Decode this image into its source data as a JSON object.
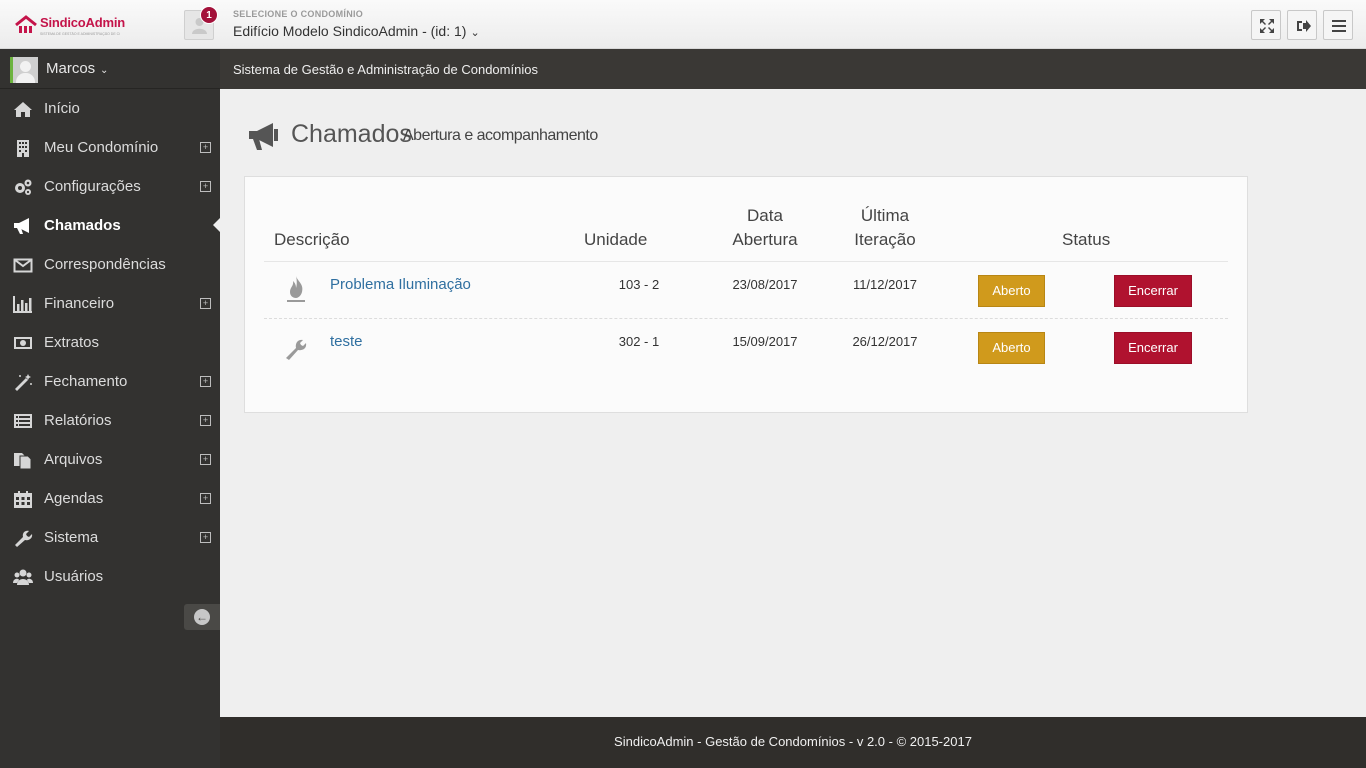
{
  "header": {
    "brand": "SindicoAdmin",
    "brand_tagline": "SISTEMA DE GESTÃO E ADMINISTRAÇÃO DE CONDOMÍNIOS",
    "notification_count": "1",
    "condo_label": "SELECIONE O CONDOMÍNIO",
    "condo_selected": "Edifício Modelo SindicoAdmin - (id: 1)",
    "buttons": [
      "expand-icon",
      "logout-icon",
      "menu-icon"
    ]
  },
  "user": {
    "name": "Marcos"
  },
  "sidebar": {
    "items": [
      {
        "label": "Início",
        "icon": "home-icon",
        "expandable": false
      },
      {
        "label": "Meu Condomínio",
        "icon": "building-icon",
        "expandable": true
      },
      {
        "label": "Configurações",
        "icon": "cogs-icon",
        "expandable": true
      },
      {
        "label": "Chamados",
        "icon": "megaphone-icon",
        "expandable": false,
        "active": true
      },
      {
        "label": "Correspondências",
        "icon": "envelope-icon",
        "expandable": false
      },
      {
        "label": "Financeiro",
        "icon": "bar-chart-icon",
        "expandable": true
      },
      {
        "label": "Extratos",
        "icon": "money-icon",
        "expandable": false
      },
      {
        "label": "Fechamento",
        "icon": "magic-wand-icon",
        "expandable": true
      },
      {
        "label": "Relatórios",
        "icon": "list-alt-icon",
        "expandable": true
      },
      {
        "label": "Arquivos",
        "icon": "files-icon",
        "expandable": true
      },
      {
        "label": "Agendas",
        "icon": "calendar-icon",
        "expandable": true
      },
      {
        "label": "Sistema",
        "icon": "wrench-icon",
        "expandable": true
      },
      {
        "label": "Usuários",
        "icon": "users-icon",
        "expandable": false
      }
    ]
  },
  "breadcrumb": "Sistema de Gestão e Administração de Condomínios",
  "page": {
    "title": "Chamados",
    "subtitle": "Abertura e acompanhamento"
  },
  "table": {
    "headers": {
      "descricao": "Descrição",
      "unidade": "Unidade",
      "data_abertura_1": "Data",
      "data_abertura_2": "Abertura",
      "ultima_1": "Última",
      "ultima_2": "Iteração",
      "status": "Status"
    },
    "rows": [
      {
        "icon": "fire-icon",
        "descricao": "Problema Iluminação",
        "unidade": "103 - 2",
        "data_abertura": "23/08/2017",
        "ultima_iteracao": "11/12/2017",
        "status": "Aberto",
        "action": "Encerrar"
      },
      {
        "icon": "wrench-icon",
        "descricao": "teste",
        "unidade": "302 - 1",
        "data_abertura": "15/09/2017",
        "ultima_iteracao": "26/12/2017",
        "status": "Aberto",
        "action": "Encerrar"
      }
    ]
  },
  "footer": "SindicoAdmin - Gestão de Condomínios - v 2.0 - © 2015-2017",
  "colors": {
    "sidebar_bg": "#333230",
    "status_open": "#d09a1c",
    "close_button": "#b0122f",
    "link": "#2f6fa0",
    "brand": "#c4144a"
  }
}
